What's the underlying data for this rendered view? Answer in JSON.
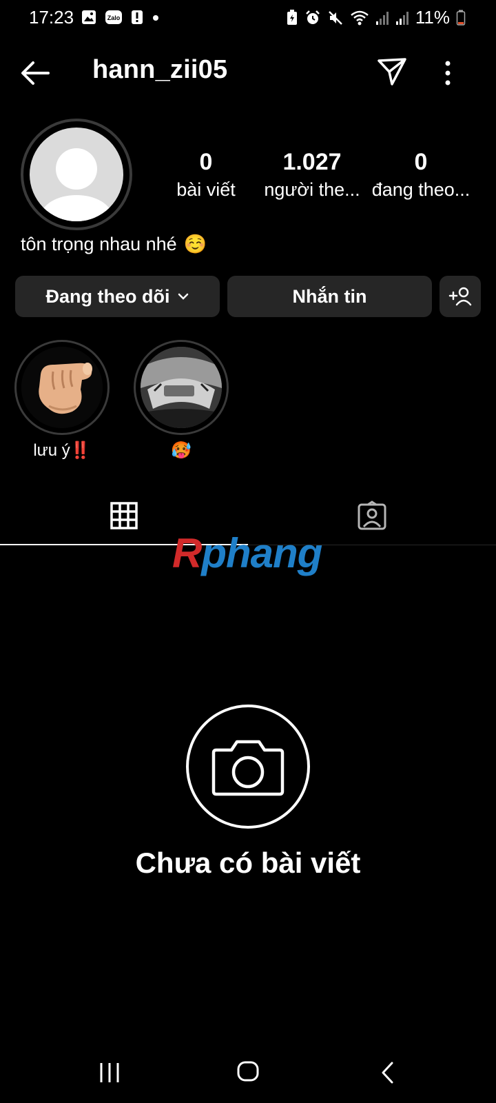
{
  "status_bar": {
    "time": "17:23",
    "battery": "11%",
    "icons_left": [
      "gallery-icon",
      "zalo-icon",
      "alert-icon",
      "dot-icon"
    ],
    "icons_right": [
      "battery-saver-icon",
      "alarm-icon",
      "mute-icon",
      "wifi-icon",
      "signal-icon",
      "signal-icon",
      "battery-icon"
    ],
    "zalo_label": "Zalo"
  },
  "header": {
    "username": "hann_zii05"
  },
  "profile": {
    "stats": [
      {
        "value": "0",
        "label": "bài viết"
      },
      {
        "value": "1.027",
        "label": "người the..."
      },
      {
        "value": "0",
        "label": "đang theo..."
      }
    ],
    "bio": "tôn trọng nhau nhé",
    "bio_emoji": "☺️"
  },
  "actions": {
    "following_label": "Đang theo dõi",
    "message_label": "Nhắn tin"
  },
  "highlights": [
    {
      "label": "lưu ý‼️"
    },
    {
      "label": "🥵"
    }
  ],
  "watermark": {
    "part1": "R",
    "part2": "phang"
  },
  "empty_state": {
    "title": "Chưa có bài viết"
  },
  "colors": {
    "background": "#000000",
    "button_bg": "#262626",
    "avatar_bg": "#dbdbdb"
  }
}
